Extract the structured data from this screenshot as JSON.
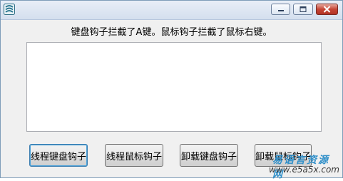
{
  "window": {
    "title": "",
    "app_icon": "app-logo-icon",
    "controls": {
      "minimize_icon": "minimize-icon",
      "maximize_icon": "maximize-icon",
      "close_icon": "close-icon"
    }
  },
  "status": {
    "message": "键盘钩子拦截了A键。鼠标钩子拦截了鼠标右键。"
  },
  "log": {
    "value": ""
  },
  "buttons": {
    "thread_keyboard_hook": "线程键盘钩子",
    "thread_mouse_hook": "线程鼠标钩子",
    "unload_keyboard_hook": "卸载键盘钩子",
    "unload_mouse_hook": "卸载鼠标钩子"
  },
  "watermark": {
    "title": "易语言资源网",
    "url": "www.e5a5x.com"
  },
  "colors": {
    "window_bg": "#f0f0f0",
    "accent": "#3c7fb1",
    "close_red": "#c64535"
  }
}
